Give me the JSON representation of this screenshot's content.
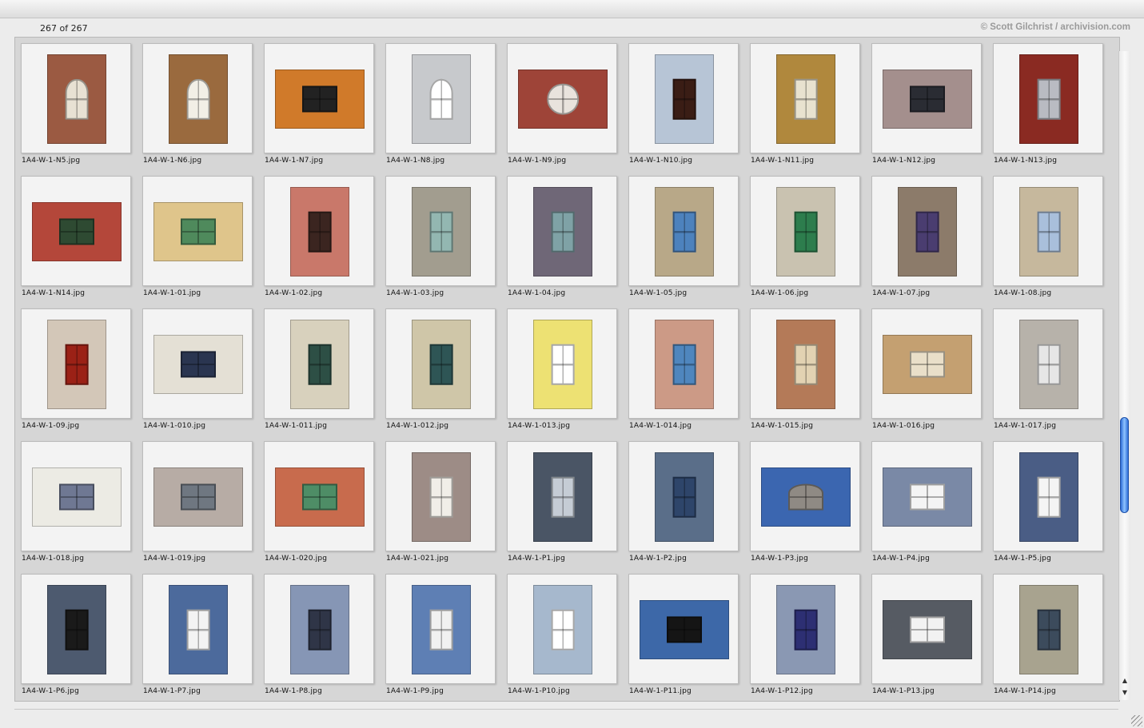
{
  "status": {
    "count": "267 of 267",
    "credit": "© Scott Gilchrist / archivision.com"
  },
  "scrollbar": {
    "position_fraction": 0.7
  },
  "thumbnails": [
    {
      "caption": "1A4-W-1-N5.jpg",
      "orientation": "portrait",
      "bg": "#9b5a42",
      "win": "#e8e1d3",
      "shape": "arched"
    },
    {
      "caption": "1A4-W-1-N6.jpg",
      "orientation": "portrait",
      "bg": "#9a6a3e",
      "win": "#f2efe6",
      "shape": "arched"
    },
    {
      "caption": "1A4-W-1-N7.jpg",
      "orientation": "landscape",
      "bg": "#d07a2a",
      "win": "#222222",
      "shape": "rect"
    },
    {
      "caption": "1A4-W-1-N8.jpg",
      "orientation": "portrait",
      "bg": "#c7c9cc",
      "win": "#ffffff",
      "shape": "arched"
    },
    {
      "caption": "1A4-W-1-N9.jpg",
      "orientation": "landscape",
      "bg": "#9e4438",
      "win": "#e9e3dd",
      "shape": "round"
    },
    {
      "caption": "1A4-W-1-N10.jpg",
      "orientation": "portrait",
      "bg": "#b7c5d6",
      "win": "#3a1d15",
      "shape": "rect"
    },
    {
      "caption": "1A4-W-1-N11.jpg",
      "orientation": "portrait",
      "bg": "#b0883d",
      "win": "#e8e2cf",
      "shape": "rect"
    },
    {
      "caption": "1A4-W-1-N12.jpg",
      "orientation": "landscape",
      "bg": "#a48f8d",
      "win": "#2a2c33",
      "shape": "rect"
    },
    {
      "caption": "1A4-W-1-N13.jpg",
      "orientation": "portrait",
      "bg": "#8a2a22",
      "win": "#b9bbc2",
      "shape": "rect"
    },
    {
      "caption": "1A4-W-1-N14.jpg",
      "orientation": "landscape",
      "bg": "#b4473a",
      "win": "#2e4a32",
      "shape": "rect"
    },
    {
      "caption": "1A4-W-1-01.jpg",
      "orientation": "landscape",
      "bg": "#dfc58b",
      "win": "#4f8a5c",
      "shape": "rect"
    },
    {
      "caption": "1A4-W-1-02.jpg",
      "orientation": "portrait",
      "bg": "#c9786a",
      "win": "#3b2520",
      "shape": "rect"
    },
    {
      "caption": "1A4-W-1-03.jpg",
      "orientation": "portrait",
      "bg": "#a29d8f",
      "win": "#93b7b1",
      "shape": "rect"
    },
    {
      "caption": "1A4-W-1-04.jpg",
      "orientation": "portrait",
      "bg": "#6f6777",
      "win": "#7fa2a6",
      "shape": "rect"
    },
    {
      "caption": "1A4-W-1-05.jpg",
      "orientation": "portrait",
      "bg": "#b8a888",
      "win": "#4d82bd",
      "shape": "rect"
    },
    {
      "caption": "1A4-W-1-06.jpg",
      "orientation": "portrait",
      "bg": "#c9c2b0",
      "win": "#2d7d4d",
      "shape": "rect"
    },
    {
      "caption": "1A4-W-1-07.jpg",
      "orientation": "portrait",
      "bg": "#8c7b6a",
      "win": "#4a3d70",
      "shape": "rect"
    },
    {
      "caption": "1A4-W-1-08.jpg",
      "orientation": "portrait",
      "bg": "#c6b89d",
      "win": "#a9bfdb",
      "shape": "rect"
    },
    {
      "caption": "1A4-W-1-09.jpg",
      "orientation": "portrait",
      "bg": "#d3c7b8",
      "win": "#9b2116",
      "shape": "rect"
    },
    {
      "caption": "1A4-W-1-010.jpg",
      "orientation": "landscape",
      "bg": "#e4e0d5",
      "win": "#2a3550",
      "shape": "rect"
    },
    {
      "caption": "1A4-W-1-011.jpg",
      "orientation": "portrait",
      "bg": "#d8d1bd",
      "win": "#2d4f45",
      "shape": "rect"
    },
    {
      "caption": "1A4-W-1-012.jpg",
      "orientation": "portrait",
      "bg": "#cfc6a8",
      "win": "#2e5555",
      "shape": "rect"
    },
    {
      "caption": "1A4-W-1-013.jpg",
      "orientation": "portrait",
      "bg": "#ede173",
      "win": "#ffffff",
      "shape": "rect"
    },
    {
      "caption": "1A4-W-1-014.jpg",
      "orientation": "portrait",
      "bg": "#cc9a86",
      "win": "#4f86be",
      "shape": "rect"
    },
    {
      "caption": "1A4-W-1-015.jpg",
      "orientation": "portrait",
      "bg": "#b47a58",
      "win": "#e2d2b2",
      "shape": "rect"
    },
    {
      "caption": "1A4-W-1-016.jpg",
      "orientation": "landscape",
      "bg": "#c4a071",
      "win": "#e9dfc9",
      "shape": "rect"
    },
    {
      "caption": "1A4-W-1-017.jpg",
      "orientation": "portrait",
      "bg": "#b7b2aa",
      "win": "#e6e6e6",
      "shape": "rect"
    },
    {
      "caption": "1A4-W-1-018.jpg",
      "orientation": "landscape",
      "bg": "#ecebe4",
      "win": "#6f7893",
      "shape": "rect"
    },
    {
      "caption": "1A4-W-1-019.jpg",
      "orientation": "landscape",
      "bg": "#b7aca5",
      "win": "#6f7781",
      "shape": "rect"
    },
    {
      "caption": "1A4-W-1-020.jpg",
      "orientation": "landscape",
      "bg": "#c86b4d",
      "win": "#4e8d66",
      "shape": "rect"
    },
    {
      "caption": "1A4-W-1-021.jpg",
      "orientation": "portrait",
      "bg": "#9d8c86",
      "win": "#f1eee8",
      "shape": "rect"
    },
    {
      "caption": "1A4-W-1-P1.jpg",
      "orientation": "portrait",
      "bg": "#4a5565",
      "win": "#c5ccd5",
      "shape": "rect"
    },
    {
      "caption": "1A4-W-1-P2.jpg",
      "orientation": "portrait",
      "bg": "#5a6e89",
      "win": "#2e456a",
      "shape": "rect"
    },
    {
      "caption": "1A4-W-1-P3.jpg",
      "orientation": "landscape",
      "bg": "#3b66b0",
      "win": "#8f8a84",
      "shape": "arched"
    },
    {
      "caption": "1A4-W-1-P4.jpg",
      "orientation": "landscape",
      "bg": "#7a89a6",
      "win": "#f4f4f4",
      "shape": "rect"
    },
    {
      "caption": "1A4-W-1-P5.jpg",
      "orientation": "portrait",
      "bg": "#4a5d85",
      "win": "#f4f4f4",
      "shape": "rect"
    },
    {
      "caption": "1A4-W-1-P6.jpg",
      "orientation": "portrait",
      "bg": "#4d5a6f",
      "win": "#1a1a1a",
      "shape": "rect"
    },
    {
      "caption": "1A4-W-1-P7.jpg",
      "orientation": "portrait",
      "bg": "#4c6a9c",
      "win": "#f3f3f3",
      "shape": "rect"
    },
    {
      "caption": "1A4-W-1-P8.jpg",
      "orientation": "portrait",
      "bg": "#8696b5",
      "win": "#2f3547",
      "shape": "rect"
    },
    {
      "caption": "1A4-W-1-P9.jpg",
      "orientation": "portrait",
      "bg": "#5e7fb4",
      "win": "#f1f1f1",
      "shape": "rect"
    },
    {
      "caption": "1A4-W-1-P10.jpg",
      "orientation": "portrait",
      "bg": "#a6b8cd",
      "win": "#ffffff",
      "shape": "rect"
    },
    {
      "caption": "1A4-W-1-P11.jpg",
      "orientation": "landscape",
      "bg": "#3d68a8",
      "win": "#151515",
      "shape": "rect"
    },
    {
      "caption": "1A4-W-1-P12.jpg",
      "orientation": "portrait",
      "bg": "#8a98b3",
      "win": "#2d2f73",
      "shape": "rect"
    },
    {
      "caption": "1A4-W-1-P13.jpg",
      "orientation": "landscape",
      "bg": "#565b63",
      "win": "#f2f2f2",
      "shape": "rect"
    },
    {
      "caption": "1A4-W-1-P14.jpg",
      "orientation": "portrait",
      "bg": "#a8a38f",
      "win": "#3c4b5c",
      "shape": "rect"
    }
  ]
}
